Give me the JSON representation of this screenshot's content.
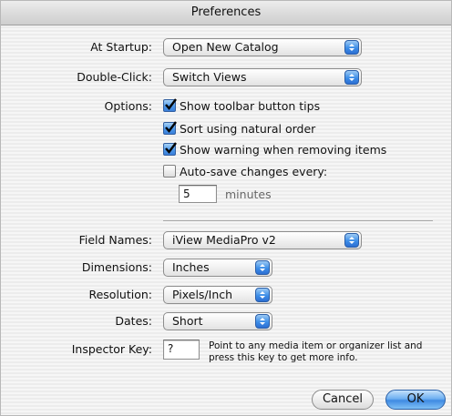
{
  "window": {
    "title": "Preferences"
  },
  "startup": {
    "label": "At Startup:",
    "value": "Open New Catalog"
  },
  "double_click": {
    "label": "Double-Click:",
    "value": "Switch Views"
  },
  "options": {
    "label": "Options:",
    "items": [
      {
        "label": "Show toolbar button tips",
        "checked": true
      },
      {
        "label": "Sort using natural order",
        "checked": true
      },
      {
        "label": "Show warning when removing items",
        "checked": true
      },
      {
        "label": "Auto-save changes every:",
        "checked": false
      }
    ],
    "autosave_value": "5",
    "autosave_unit": "minutes"
  },
  "field_names": {
    "label": "Field Names:",
    "value": "iView MediaPro v2"
  },
  "dimensions": {
    "label": "Dimensions:",
    "value": "Inches"
  },
  "resolution": {
    "label": "Resolution:",
    "value": "Pixels/Inch"
  },
  "dates": {
    "label": "Dates:",
    "value": "Short"
  },
  "inspector": {
    "label": "Inspector Key:",
    "value": "?",
    "help_line1": "Point to any media item or organizer list and",
    "help_line2": "press this key to get more info."
  },
  "buttons": {
    "cancel": "Cancel",
    "ok": "OK"
  },
  "colors": {
    "accent_blue": "#3d8ee8",
    "window_bg": "#ececec"
  }
}
